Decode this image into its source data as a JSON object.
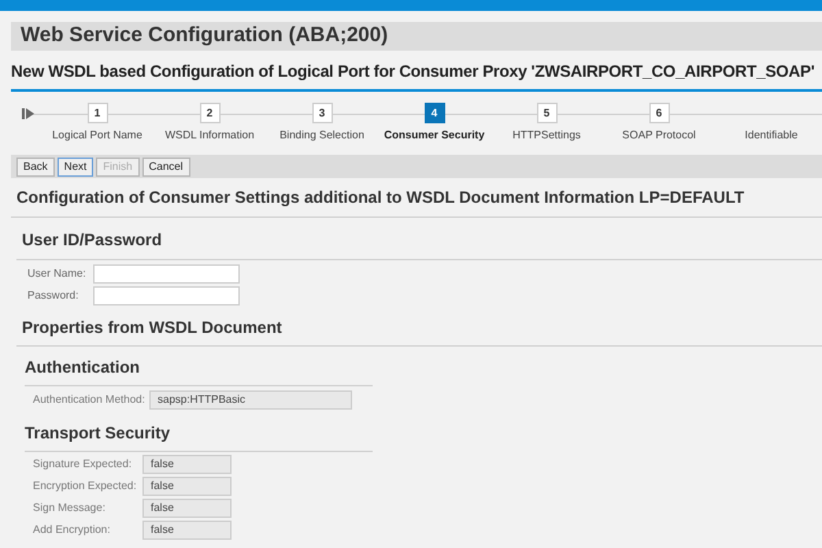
{
  "window": {
    "title": "Web Service Configuration (ABA;200)"
  },
  "subtitle": "New WSDL based Configuration of Logical Port for Consumer Proxy 'ZWSAIRPORT_CO_AIRPORT_SOAP'",
  "steps": [
    {
      "number": "1",
      "label": "Logical Port Name",
      "selected": false
    },
    {
      "number": "2",
      "label": "WSDL Information",
      "selected": false
    },
    {
      "number": "3",
      "label": "Binding Selection",
      "selected": false
    },
    {
      "number": "4",
      "label": "Consumer Security",
      "selected": true
    },
    {
      "number": "5",
      "label": "HTTPSettings",
      "selected": false
    },
    {
      "number": "6",
      "label": "SOAP Protocol",
      "selected": false
    },
    {
      "label": "Identifiable",
      "selected": false
    }
  ],
  "buttons": [
    {
      "label": "Back",
      "disabled": false,
      "focused": false
    },
    {
      "label": "Next",
      "disabled": false,
      "focused": true
    },
    {
      "label": "Finish",
      "disabled": true,
      "focused": false
    },
    {
      "label": "Cancel",
      "disabled": false,
      "focused": false
    }
  ],
  "section_title": "Configuration of Consumer Settings additional to WSDL Document Information LP=DEFAULT",
  "user_group": {
    "title": "User ID/Password",
    "fields": [
      {
        "label": "User Name:"
      },
      {
        "label": "Password:"
      }
    ]
  },
  "properties": {
    "title": "Properties from WSDL Document",
    "authentication": {
      "title": "Authentication",
      "fields": [
        {
          "label": "Authentication Method:",
          "value": "sapsp:HTTPBasic"
        }
      ]
    },
    "transport_security": {
      "title": "Transport Security",
      "fields": [
        {
          "label": "Signature Expected:",
          "value": "false"
        },
        {
          "label": "Encryption Expected:",
          "value": "false"
        },
        {
          "label": "Sign Message:",
          "value": "false"
        },
        {
          "label": "Add Encryption:",
          "value": "false"
        }
      ]
    }
  }
}
